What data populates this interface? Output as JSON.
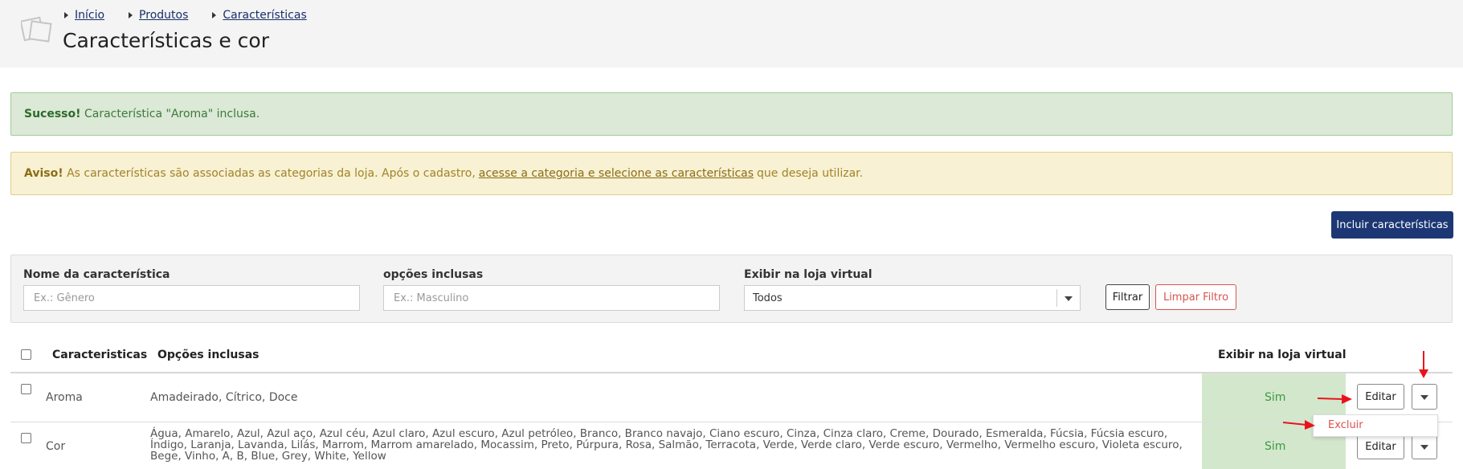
{
  "breadcrumb": {
    "items": [
      "Início",
      "Produtos",
      "Características"
    ]
  },
  "page": {
    "title": "Características e cor"
  },
  "alerts": {
    "success": {
      "label": "Sucesso!",
      "text": "Característica \"Aroma\" inclusa."
    },
    "warning": {
      "label": "Aviso!",
      "text_before": "As características são associadas as categorias da loja. Após o cadastro,",
      "link": "acesse a categoria e selecione as características",
      "text_after": "que deseja utilizar."
    }
  },
  "actions": {
    "add_button": "Incluir características"
  },
  "filters": {
    "name": {
      "label": "Nome da característica",
      "placeholder": "Ex.: Gênero"
    },
    "options": {
      "label": "opções inclusas",
      "placeholder": "Ex.: Masculino"
    },
    "show": {
      "label": "Exibir na loja virtual",
      "value": "Todos"
    },
    "filter_button": "Filtrar",
    "clear_button": "Limpar Filtro"
  },
  "table": {
    "headers": {
      "name": "Caracteristicas",
      "options": "Opções inclusas",
      "show": "Exibir na loja virtual"
    },
    "rows": [
      {
        "name": "Aroma",
        "options": "Amadeirado, Cítrico, Doce",
        "show": "Sim",
        "edit": "Editar"
      },
      {
        "name": "Cor",
        "options": "Água, Amarelo, Azul, Azul aço, Azul céu, Azul claro, Azul escuro, Azul petróleo, Branco, Branco navajo, Ciano escuro, Cinza, Cinza claro, Creme, Dourado, Esmeralda, Fúcsia, Fúcsia escuro, Índigo, Laranja, Lavanda, Lilás, Marrom, Marrom amarelado, Mocassim, Preto, Púrpura, Rosa, Salmão, Terracota, Verde, Verde claro, Verde escuro, Vermelho, Vermelho escuro, Violeta escuro, Bege, Vinho, A, B, Blue, Grey, White, Yellow",
        "show": "Sim",
        "edit": "Editar"
      }
    ],
    "row_menu": {
      "delete": "Excluir"
    }
  },
  "colors": {
    "primary": "#1c3774",
    "success_bg": "#dbe9d6",
    "warning_bg": "#f8f1d3",
    "danger": "#d9534f",
    "annotation_arrow": "#e8141c"
  }
}
